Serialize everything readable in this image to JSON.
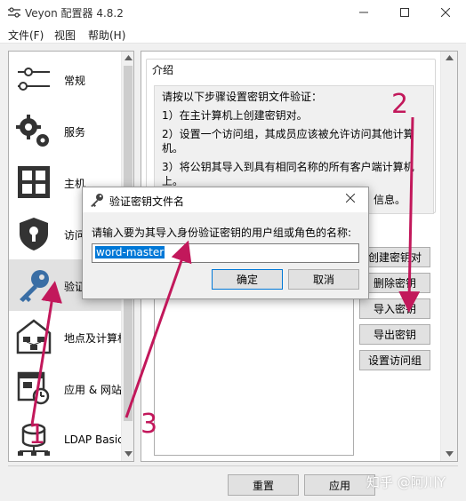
{
  "window": {
    "title": "Veyon 配置器 4.8.2"
  },
  "menu": [
    "文件(F)",
    "视图",
    "帮助(H)"
  ],
  "sidebar": {
    "items": [
      {
        "label": "常规",
        "icon": "sliders-icon"
      },
      {
        "label": "服务",
        "icon": "gears-icon"
      },
      {
        "label": "主机",
        "icon": "grid-icon"
      },
      {
        "label": "访问",
        "icon": "shield-keyhole-icon"
      },
      {
        "label": "验证",
        "icon": "key-icon",
        "selected": true
      },
      {
        "label": "地点及计算机",
        "icon": "network-house-icon"
      },
      {
        "label": "应用 & 网站",
        "icon": "window-clock-icon"
      },
      {
        "label": "LDAP Basic",
        "icon": "database-network-icon"
      }
    ]
  },
  "intro": {
    "title": "介绍",
    "lines": [
      "请按以下步骤设置密钥文件验证：",
      "1）在主计算机上创建密钥对。",
      "2）设置一个访问组，其成员应该被允许访问其他计算机。",
      "3）将公钥其导入到具有相同名称的所有客户端计算机上。",
      "信息。"
    ]
  },
  "key_buttons": {
    "create": "创建密钥对",
    "delete": "删除密钥",
    "import": "导入密钥",
    "export": "导出密钥",
    "set_group": "设置访问组"
  },
  "bottom": {
    "reset": "重置",
    "apply": "应用"
  },
  "watermark": "知乎 @阿川Y",
  "dialog": {
    "title": "验证密钥文件名",
    "prompt": "请输入要为其导入身份验证密钥的用户组或角色的名称:",
    "input_value": "word-master",
    "ok": "确定",
    "cancel": "取消"
  },
  "annotations": {
    "step1": "1",
    "step2": "2",
    "step3": "3",
    "color": "#c2185b"
  }
}
